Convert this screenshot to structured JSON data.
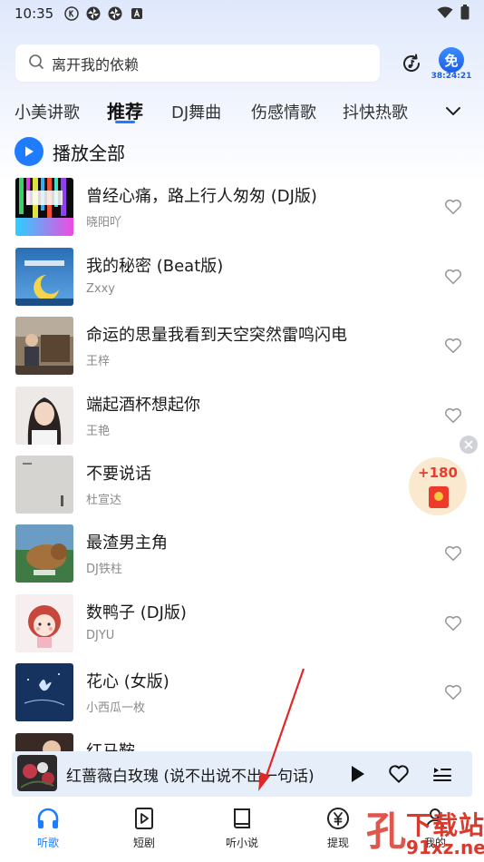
{
  "status_bar": {
    "time": "10:35",
    "icons": [
      "k-circle-icon",
      "pinwheel-icon",
      "pinwheel-icon",
      "a-square-icon"
    ],
    "right_icons": [
      "wifi-icon",
      "battery-icon"
    ]
  },
  "search": {
    "placeholder": "离开我的依赖"
  },
  "free_badge": {
    "label": "免",
    "timer": "38:24:21"
  },
  "tabs": [
    "小美讲歌",
    "推荐",
    "DJ舞曲",
    "伤感情歌",
    "抖快热歌"
  ],
  "active_tab": "推荐",
  "play_all_label": "播放全部",
  "songs": [
    {
      "title": "曾经心痛，路上行人匆匆 (DJ版)",
      "artist": "晓阳吖"
    },
    {
      "title": "我的秘密 (Beat版)",
      "artist": "Zxxy"
    },
    {
      "title": "命运的思量我看到天空突然雷鸣闪电",
      "artist": "王梓"
    },
    {
      "title": "端起酒杯想起你",
      "artist": "王艳"
    },
    {
      "title": "不要说话",
      "artist": "杜宣达"
    },
    {
      "title": "最渣男主角",
      "artist": "DJ铁柱"
    },
    {
      "title": "数鸭子 (DJ版)",
      "artist": "DJYU"
    },
    {
      "title": "花心 (女版)",
      "artist": "小西瓜一枚"
    },
    {
      "title": "红马鞍",
      "artist": ""
    }
  ],
  "red_packet": {
    "amount": "+180"
  },
  "mini_player": {
    "title": "红蔷薇白玫瑰 (说不出说不出一句话)"
  },
  "bottom_nav": [
    {
      "label": "听歌",
      "icon": "headphones-icon",
      "active": true
    },
    {
      "label": "短剧",
      "icon": "play-square-icon",
      "active": false
    },
    {
      "label": "听小说",
      "icon": "book-icon",
      "active": false
    },
    {
      "label": "提现",
      "icon": "yuan-circle-icon",
      "active": false
    },
    {
      "label": "我的",
      "icon": "user-icon",
      "active": false
    }
  ],
  "watermark": {
    "top": "下载站",
    "bottom": "91xz.net"
  },
  "colors": {
    "accent": "#1f7cff",
    "red": "#ee3a2c"
  }
}
